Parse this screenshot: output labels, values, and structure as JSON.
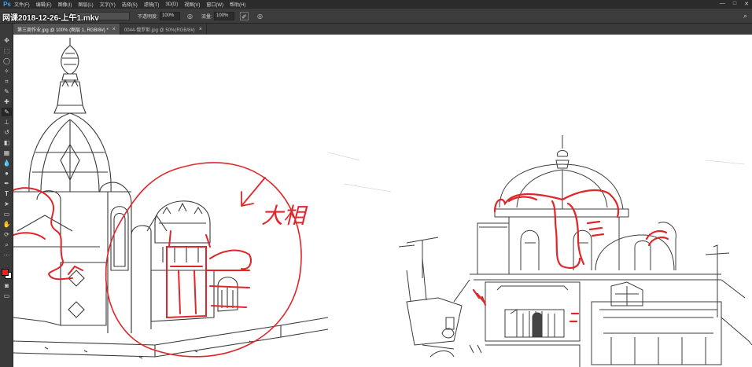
{
  "app": {
    "logo": "Ps"
  },
  "menu": [
    "文件(F)",
    "编辑(E)",
    "图像(I)",
    "图层(L)",
    "文字(Y)",
    "选择(S)",
    "滤镜(T)",
    "3D(D)",
    "视图(V)",
    "窗口(W)",
    "帮助(H)"
  ],
  "window_controls": [
    "—",
    "□",
    "✕"
  ],
  "options": {
    "file_overlay": "网课2018-12-26-上午1.mkv",
    "opacity_label": "不透明度:",
    "opacity_value": "100%",
    "flow_label": "流量:",
    "flow_value": "100%"
  },
  "tabs": [
    {
      "label": "第三周作业.jpg @ 100% (图层 1, RGB/8#) *",
      "active": true
    },
    {
      "label": "0044-俄罗斯.jpg @ 50%(RGB/8#)",
      "active": false
    }
  ],
  "tab_close": "×",
  "canvas": {
    "annotation_text": "大相"
  },
  "colors": {
    "foreground": "#ff1c1c",
    "background": "#ffffff",
    "annotation": "#e0262a"
  }
}
